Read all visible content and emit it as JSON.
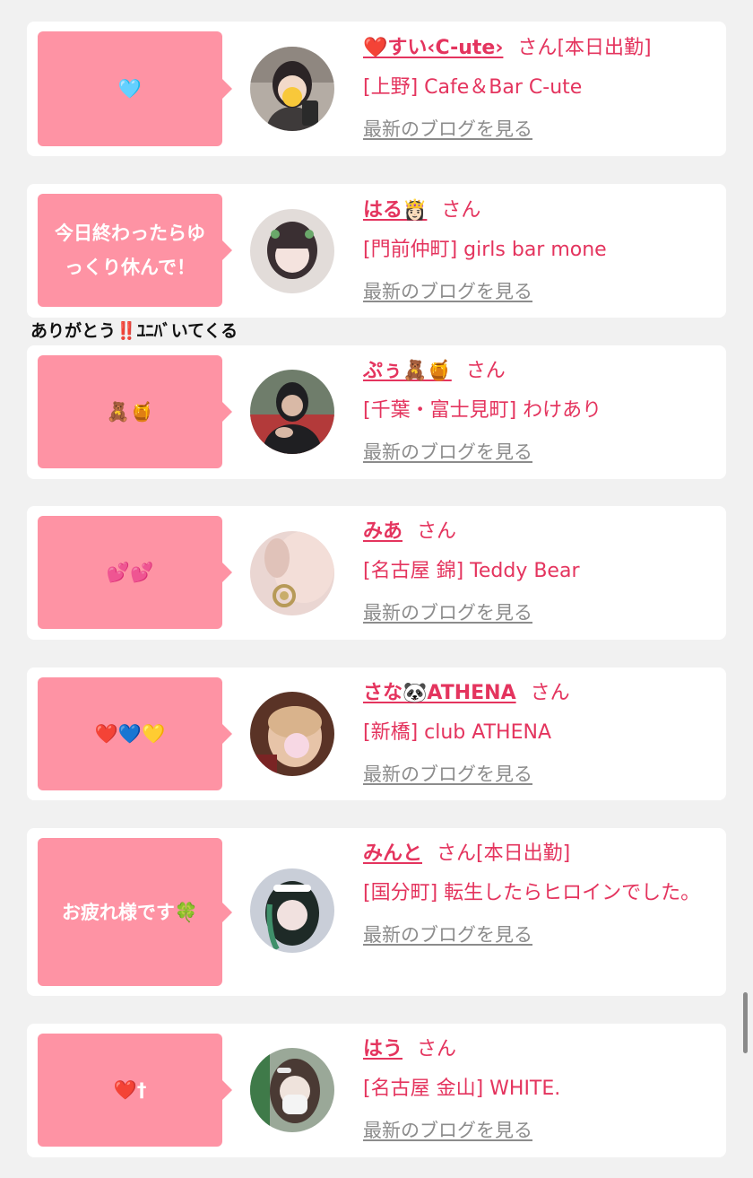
{
  "cards": [
    {
      "message": "🩵",
      "name": "❤️すい‹C-ute›",
      "san": "さん",
      "status": "[本日出勤]",
      "shop": "[上野] Cafe＆Bar C-ute",
      "blog": "最新のブログを見る",
      "avatar_icon": "profile-photo-icon"
    },
    {
      "message": "今日終わったらゆっくり休んで！",
      "name": "はる👸🏻",
      "san": "さん",
      "status": "",
      "shop": "[門前仲町] girls bar mone",
      "blog": "最新のブログを見る",
      "avatar_icon": "profile-photo-icon"
    },
    {
      "message": "🧸🍯",
      "name": "ぷぅ🧸🍯",
      "san": "さん",
      "status": "",
      "shop": "[千葉・富士見町] わけあり",
      "blog": "最新のブログを見る",
      "avatar_icon": "profile-photo-icon"
    },
    {
      "message": "💕💕",
      "name": "みあ",
      "san": "さん",
      "status": "",
      "shop": "[名古屋 錦] Teddy Bear",
      "blog": "最新のブログを見る",
      "avatar_icon": "profile-photo-icon"
    },
    {
      "message": "❤️💙💛",
      "name": "さな🐼ATHENA",
      "san": "さん",
      "status": "",
      "shop": "[新橋] club ATHENA",
      "blog": "最新のブログを見る",
      "avatar_icon": "profile-photo-icon"
    },
    {
      "message": "お疲れ様です🍀",
      "name": "みんと",
      "san": "さん",
      "status": "[本日出勤]",
      "shop": "[国分町] 転生したらヒロインでした。",
      "blog": "最新のブログを見る",
      "avatar_icon": "profile-photo-icon"
    },
    {
      "message": "❤️†",
      "name": "はう",
      "san": "さん",
      "status": "",
      "shop": "[名古屋 金山] WHITE.",
      "blog": "最新のブログを見る",
      "avatar_icon": "profile-photo-icon"
    }
  ],
  "floating_text": {
    "before": "ありがとう",
    "excl": "‼️",
    "after": "ﾕﾆﾊﾞいてくる"
  },
  "colors": {
    "accent": "#e4345e",
    "bubble": "#fe93a4",
    "link_gray": "#8c8c8c",
    "background": "#f1f1f1"
  }
}
